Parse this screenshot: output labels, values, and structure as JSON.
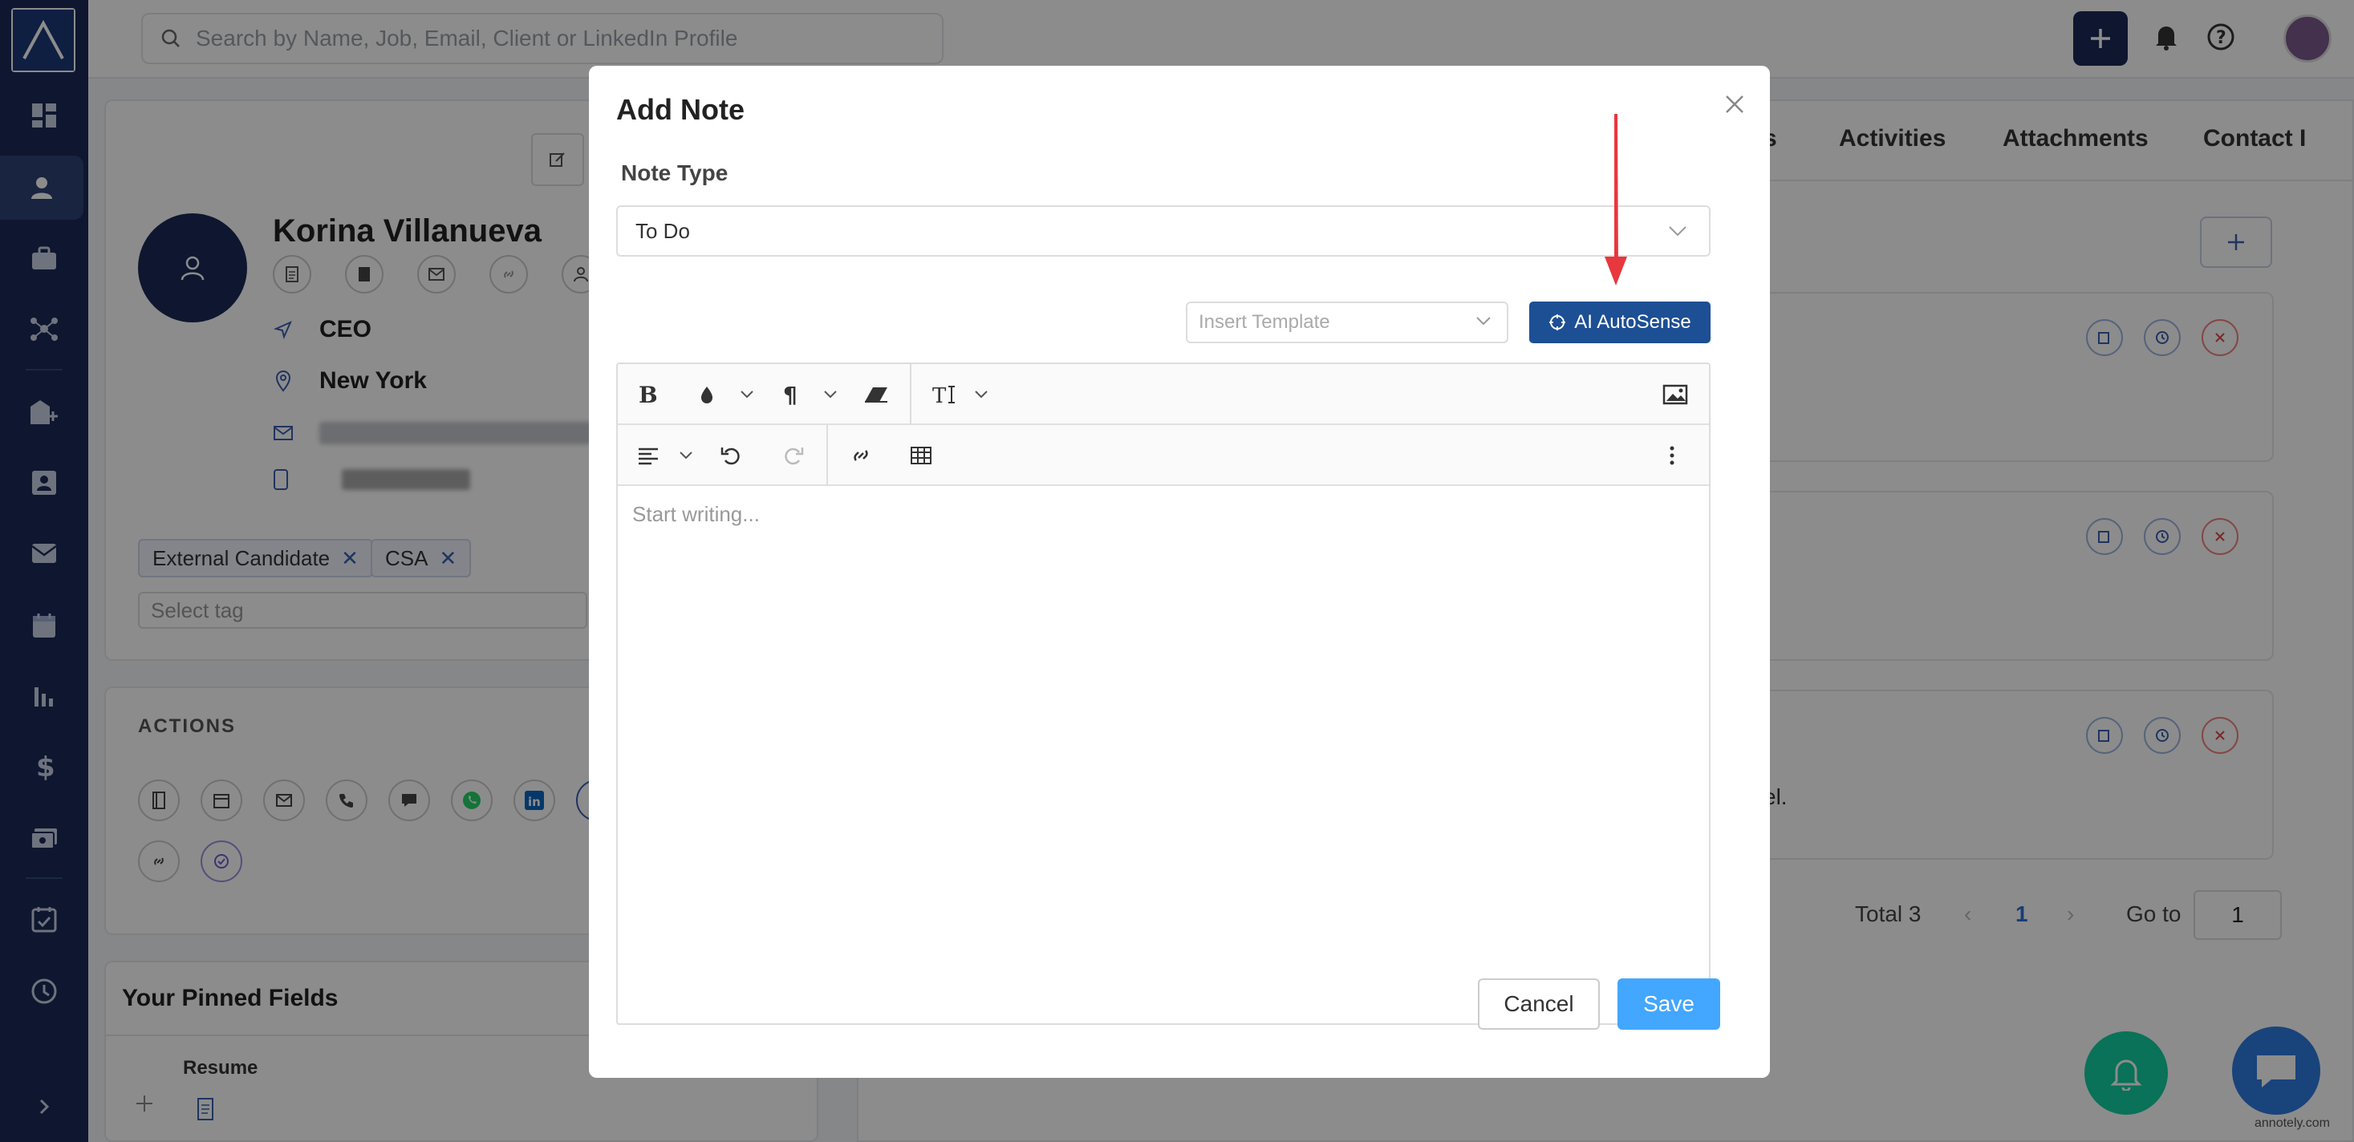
{
  "topbar": {
    "search_placeholder": "Search by Name, Job, Email, Client or LinkedIn Profile"
  },
  "profile": {
    "name": "Korina Villanueva",
    "title": "CEO",
    "location": "New York",
    "tags": [
      "External Candidate",
      "CSA"
    ],
    "select_tag_placeholder": "Select tag"
  },
  "actions": {
    "title": "ACTIONS"
  },
  "pinned": {
    "title": "Your Pinned Fields",
    "resume_label": "Resume"
  },
  "tabs": {
    "partial_left": "s",
    "activities": "Activities",
    "attachments": "Attachments",
    "contact": "Contact I"
  },
  "notes": {
    "snippet": "el."
  },
  "pagination": {
    "total": "Total 3",
    "current_page": "1",
    "goto_label": "Go to",
    "goto_value": "1"
  },
  "modal": {
    "title": "Add Note",
    "note_type_label": "Note Type",
    "note_type_value": "To Do",
    "template_placeholder": "Insert Template",
    "ai_button": "AI AutoSense",
    "editor_placeholder": "Start writing...",
    "cancel": "Cancel",
    "save": "Save"
  },
  "watermark": "annotely.com",
  "colors": {
    "nav_bg": "#1a2b57",
    "ai_button": "#1d4f94",
    "save_button": "#43a6ff",
    "annotation_arrow": "#e8373d",
    "fab_bell": "#11cfa0",
    "fab_chat": "#2e7be0"
  }
}
